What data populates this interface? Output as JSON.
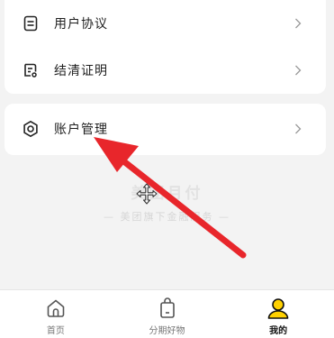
{
  "menu": {
    "items": [
      {
        "label": "用户协议",
        "icon": "document-icon"
      },
      {
        "label": "结清证明",
        "icon": "certificate-icon"
      },
      {
        "label": "账户管理",
        "icon": "gear-icon"
      }
    ]
  },
  "watermark": {
    "main": "美团月付",
    "sub": "— 美团旗下金融服务 —"
  },
  "tabbar": {
    "tabs": [
      {
        "label": "首页",
        "icon": "home-icon",
        "active": false
      },
      {
        "label": "分期好物",
        "icon": "shopping-bag-icon",
        "active": false
      },
      {
        "label": "我的",
        "icon": "user-icon",
        "active": true
      }
    ]
  },
  "colors": {
    "accent": "#ffd100",
    "arrow": "#e8262b",
    "background": "#f3f3f3"
  }
}
